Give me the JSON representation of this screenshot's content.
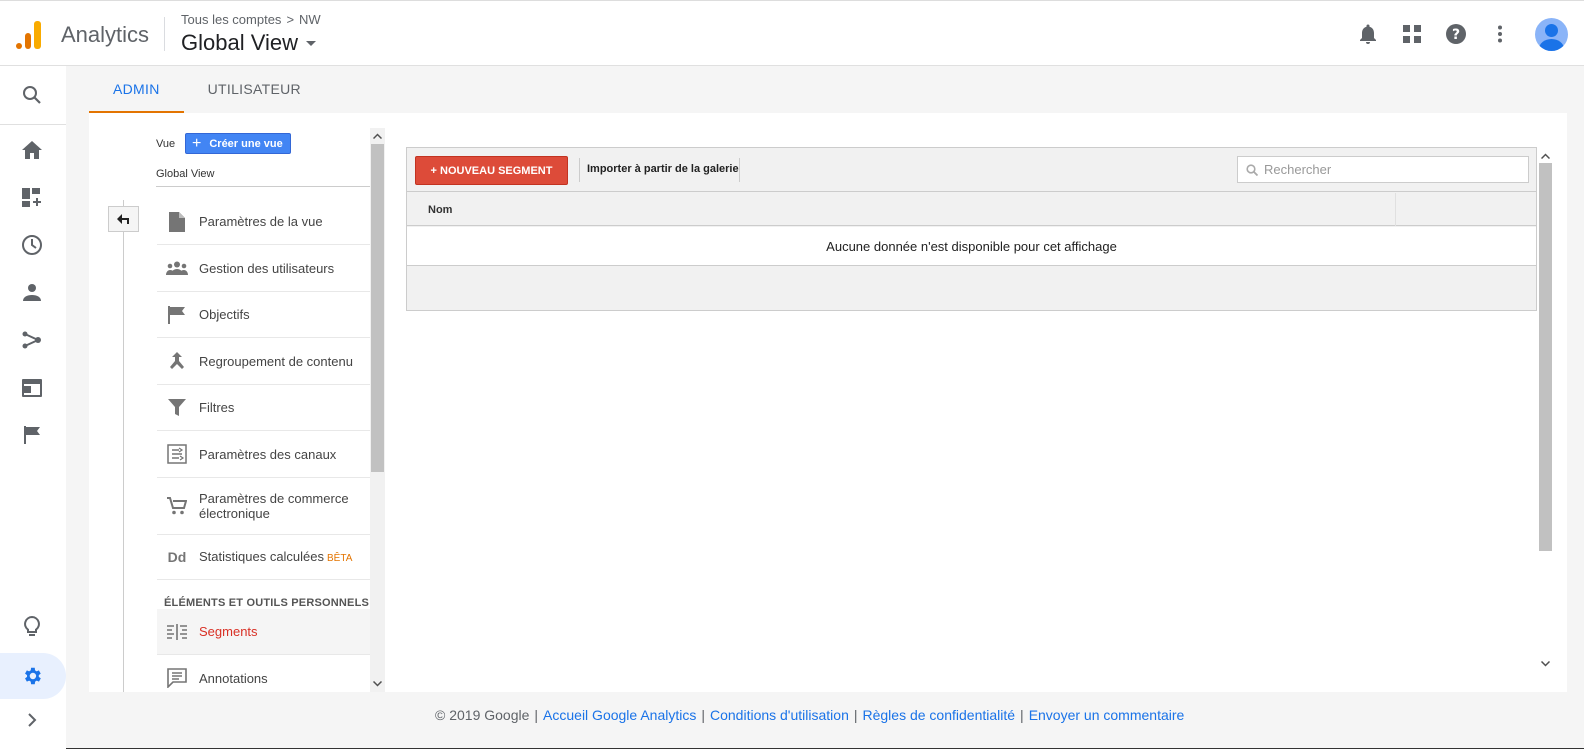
{
  "header": {
    "app_name": "Analytics",
    "breadcrumb": [
      "Tous les comptes",
      ">",
      "NW"
    ],
    "view_title": "Global View"
  },
  "tabs": [
    {
      "label": "ADMIN",
      "active": true
    },
    {
      "label": "UTILISATEUR",
      "active": false
    }
  ],
  "view_panel": {
    "vue_label": "Vue",
    "create_button": "Créer une vue",
    "view_name": "Global View"
  },
  "nav": {
    "items": [
      {
        "label": "Paramètres de la vue",
        "icon": "document-icon"
      },
      {
        "label": "Gestion des utilisateurs",
        "icon": "users-icon"
      },
      {
        "label": "Objectifs",
        "icon": "flag-icon"
      },
      {
        "label": "Regroupement de contenu",
        "icon": "merge-icon"
      },
      {
        "label": "Filtres",
        "icon": "filter-icon"
      },
      {
        "label": "Paramètres des canaux",
        "icon": "channels-icon"
      },
      {
        "label": "Paramètres de commerce électronique",
        "icon": "cart-icon"
      },
      {
        "label": "Statistiques calculées",
        "icon": "dd-icon",
        "badge": "BÊTA"
      }
    ],
    "section_header": "ÉLÉMENTS ET OUTILS PERSONNELS",
    "personal_items": [
      {
        "label": "Segments",
        "icon": "segments-icon",
        "active": true
      },
      {
        "label": "Annotations",
        "icon": "annotation-icon"
      }
    ]
  },
  "segments": {
    "new_button": "+ NOUVEAU SEGMENT",
    "import_link": "Importer à partir de la galerie",
    "search_placeholder": "Rechercher",
    "column_name": "Nom",
    "empty_message": "Aucune donnée n'est disponible pour cet affichage"
  },
  "footer": {
    "copyright": "© 2019 Google",
    "links": [
      "Accueil Google Analytics",
      "Conditions d'utilisation",
      "Règles de confidentialité",
      "Envoyer un commentaire"
    ],
    "separator": "|"
  },
  "colors": {
    "accent_blue": "#1a73e8",
    "active_tab_underline": "#e37400",
    "new_segment_red": "#dd4b39",
    "active_item_red": "#d93025"
  }
}
